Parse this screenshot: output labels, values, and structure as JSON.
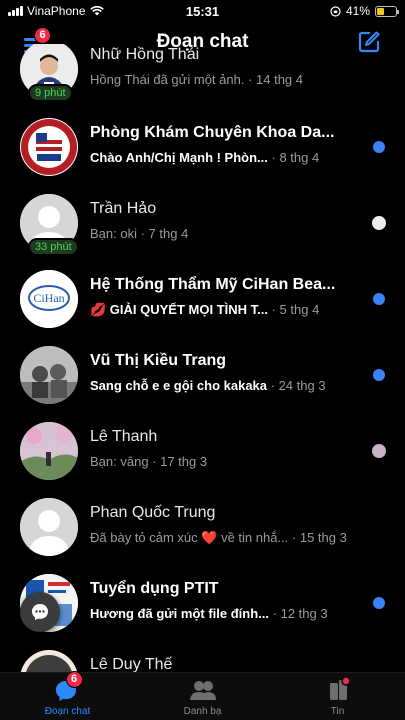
{
  "status_bar": {
    "carrier": "VinaPhone",
    "time": "15:31",
    "battery_percent": "41%",
    "battery_level": 0.41
  },
  "header": {
    "title": "Đoạn chat",
    "menu_badge": "6"
  },
  "conversations": [
    {
      "name": "Nhữ Hồng Thái",
      "preview": "Hồng Thái đã gửi một ảnh.",
      "meta": " · 14 thg 4",
      "unread": false,
      "time_badge": "9 phút"
    },
    {
      "name": "Phòng Khám Chuyên Khoa Da...",
      "preview": "Chào Anh/Chị Mạnh !  Phòn...",
      "meta": " · 8 thg 4",
      "unread": true,
      "time_badge": ""
    },
    {
      "name": "Trần Hảo",
      "preview": "Bạn: oki",
      "meta": " · 7 thg 4",
      "unread": false,
      "time_badge": "33 phút"
    },
    {
      "name": "Hệ Thống Thẩm Mỹ CiHan Bea...",
      "preview": "💋 GIẢI QUYẾT MỌI TÌNH T...",
      "meta": " · 5 thg 4",
      "unread": true,
      "time_badge": ""
    },
    {
      "name": "Vũ Thị Kiều Trang",
      "preview": "Sang chỗ e e gội cho kakaka",
      "meta": " · 24 thg 3",
      "unread": true,
      "time_badge": ""
    },
    {
      "name": "Lê Thanh",
      "preview": "Bạn: vâng",
      "meta": " · 17 thg 3",
      "unread": false,
      "time_badge": ""
    },
    {
      "name": "Phan Quốc Trung",
      "preview": "Đã bày tỏ cảm xúc ❤️ về tin nhắ...",
      "meta": " · 15 thg 3",
      "unread": false,
      "time_badge": ""
    },
    {
      "name": "Tuyển dụng PTIT",
      "preview": "Hương đã gửi một file đính...",
      "meta": " · 12 thg 3",
      "unread": true,
      "time_badge": ""
    },
    {
      "name": "Lê Duy Thế",
      "preview": "",
      "meta": "",
      "unread": false,
      "time_badge": ""
    }
  ],
  "avatar_texts": {
    "clinic_seal_top": "VIỆN THẨM MỸ QUỐC TẾ",
    "clinic_seal_bottom": "HOA KỲ",
    "cihan_logo": "CiHan"
  },
  "tabs": [
    {
      "label": "Đoạn chat",
      "badge": "6",
      "active": true
    },
    {
      "label": "Danh bạ",
      "active": false
    },
    {
      "label": "Tin",
      "active": false
    }
  ],
  "colors": {
    "accent": "#2e89ff",
    "unread_dot": "#3b82f6",
    "badge": "#f02849",
    "active_green": "#48d45a"
  }
}
